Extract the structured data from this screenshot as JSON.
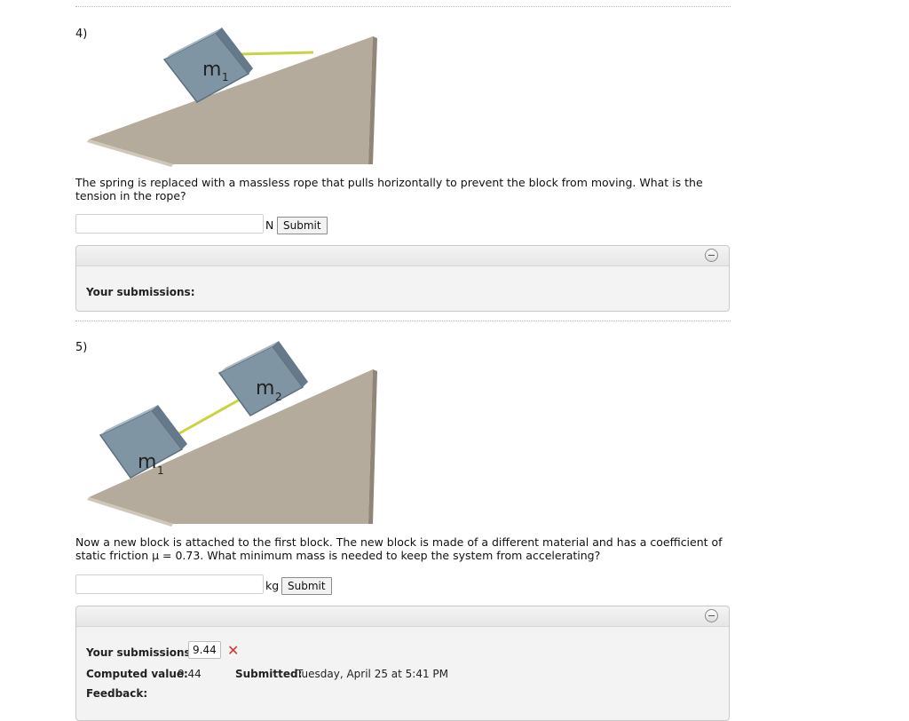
{
  "q4": {
    "number": "4)",
    "labels": {
      "m1": "m",
      "m1_sub": "1"
    },
    "question": "The spring is replaced with a massless rope that pulls horizontally to prevent the block from moving. What is the tension in the rope?",
    "unit": "N",
    "submit_label": "Submit",
    "input_value": "",
    "panel": {
      "submissions_label": "Your submissions:"
    }
  },
  "q5": {
    "number": "5)",
    "labels": {
      "m1": "m",
      "m1_sub": "1",
      "m2": "m",
      "m2_sub": "2"
    },
    "question": "Now a new block is attached to the first block. The new block is made of a different material and has a coefficient of static friction μ = 0.73. What minimum mass is needed to keep the system from accelerating?",
    "unit": "kg",
    "submit_label": "Submit",
    "input_value": "",
    "panel": {
      "submissions_label": "Your submissions:",
      "submission_value": "9.44",
      "computed_label": "Computed value:",
      "computed_value": "9.44",
      "submitted_label": "Submitted:",
      "submitted_value": "Tuesday, April 25 at 5:41 PM",
      "feedback_label": "Feedback:"
    }
  },
  "colors": {
    "ramp": "#ada395",
    "block": "#7f95a3",
    "rope": "#c9d33f",
    "error": "#d9312b"
  }
}
